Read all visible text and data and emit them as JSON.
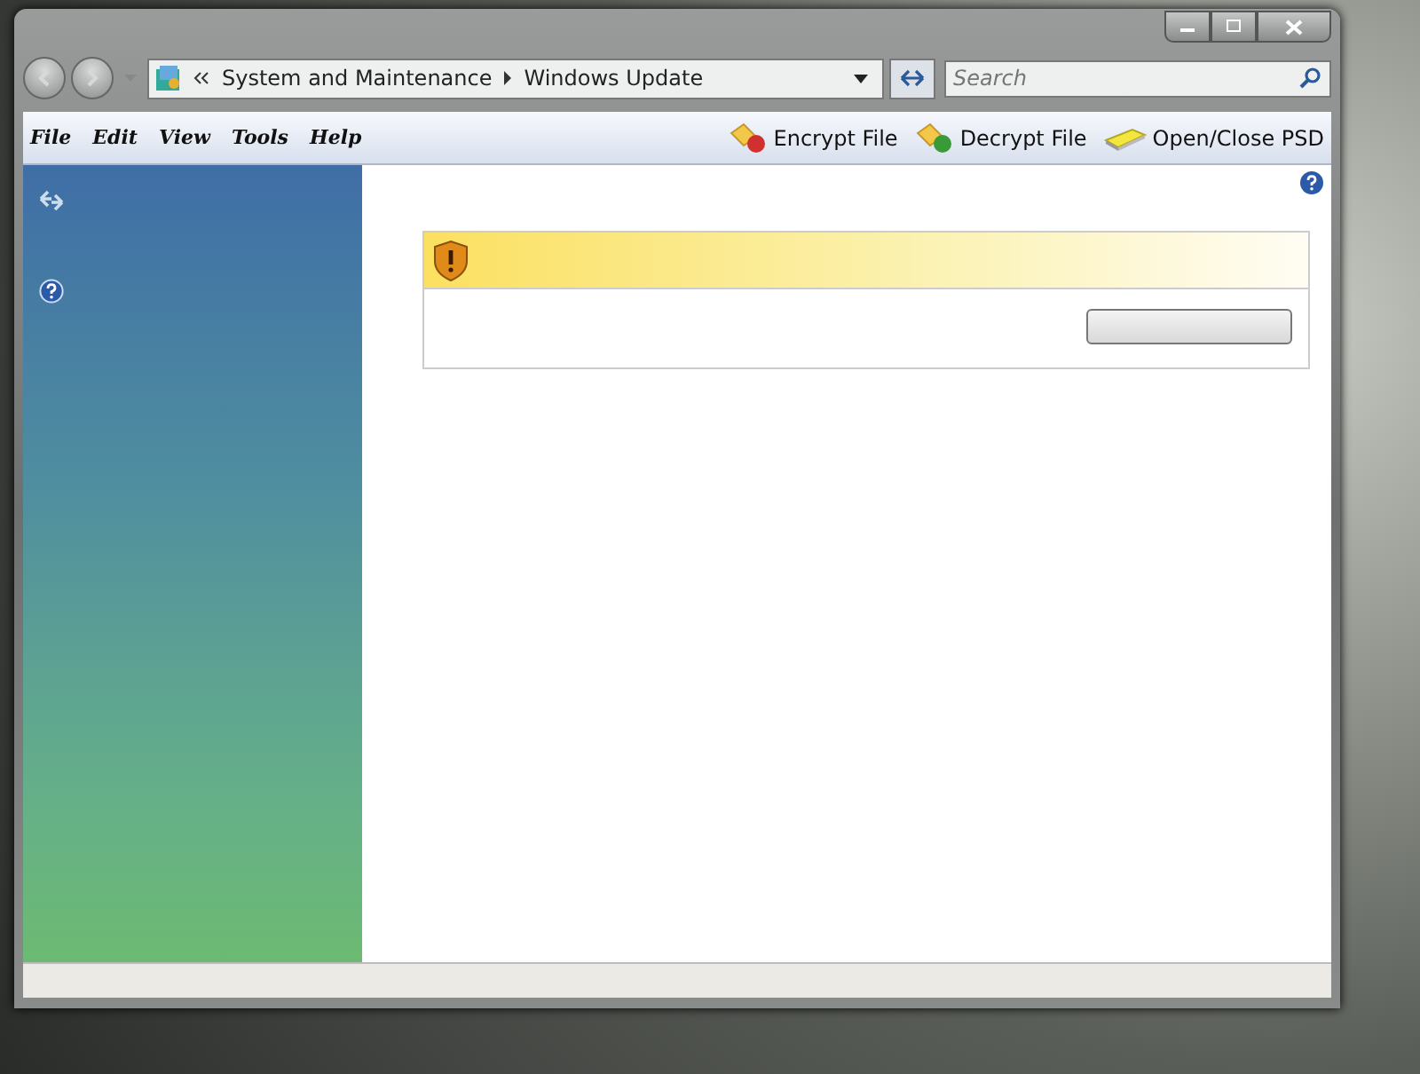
{
  "address_bar": {
    "crumbs": [
      "System and Maintenance",
      "Windows Update"
    ]
  },
  "search": {
    "placeholder": "Search"
  },
  "menu": [
    "File",
    "Edit",
    "View",
    "Tools",
    "Help"
  ],
  "toolbar": [
    {
      "label": "Encrypt File",
      "kind": "encrypt"
    },
    {
      "label": "Decrypt File",
      "kind": "decrypt"
    },
    {
      "label": "Open/Close PSD",
      "kind": "drive"
    }
  ]
}
